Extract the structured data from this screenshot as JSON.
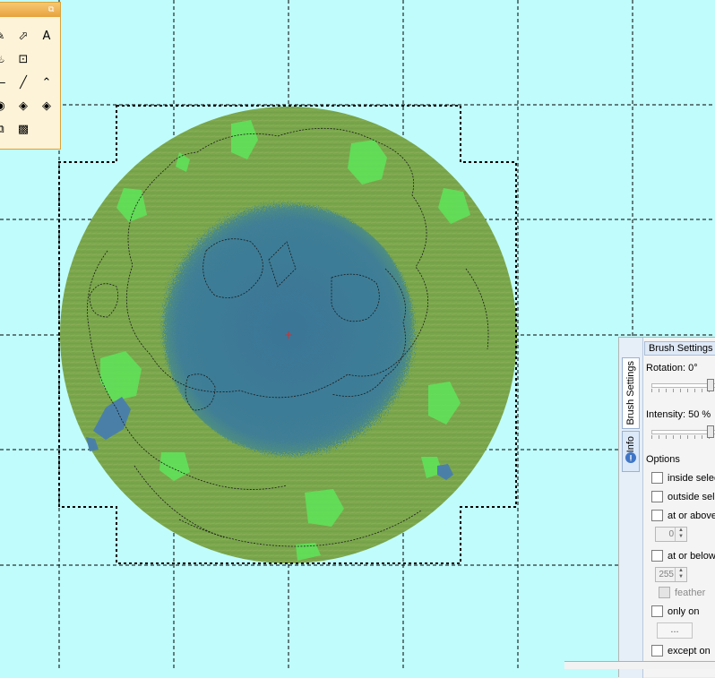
{
  "toolbox": {
    "restore_icon": "restore-window-icon",
    "tools": [
      {
        "name": "pencil-tool-icon",
        "glyph": "✎"
      },
      {
        "name": "fill-tool-icon",
        "glyph": "⬀"
      },
      {
        "name": "text-tool-icon",
        "glyph": "A"
      },
      {
        "name": "fire-tool-icon",
        "glyph": "♨"
      },
      {
        "name": "stamp-tool-icon",
        "glyph": "⊡"
      },
      {
        "name": "empty-slot",
        "glyph": ""
      },
      {
        "name": "line-tool-icon",
        "glyph": "—"
      },
      {
        "name": "slope-line-tool-icon",
        "glyph": "╱"
      },
      {
        "name": "ridge-tool-icon",
        "glyph": "⌃"
      },
      {
        "name": "erosion-tool-icon",
        "glyph": "◉"
      },
      {
        "name": "raise-tool-icon",
        "glyph": "◈"
      },
      {
        "name": "lower-tool-icon",
        "glyph": "◈"
      },
      {
        "name": "copy-tool-icon",
        "glyph": "⧉"
      },
      {
        "name": "noise-tool-icon",
        "glyph": "▩"
      },
      {
        "name": "empty-slot",
        "glyph": ""
      }
    ]
  },
  "panel": {
    "header": "Brush Settings",
    "tabs": {
      "brush_settings": "Brush Settings",
      "info": "Info"
    },
    "rotation_label": "Rotation: 0°",
    "rotation_value": 0,
    "intensity_label": "Intensity: 50 %",
    "intensity_value": 50,
    "options_label": "Options",
    "inside_selection": "inside selection",
    "outside_selection": "outside selection",
    "at_or_above": "at or above",
    "at_or_above_value": "0",
    "at_or_below": "at or below",
    "at_or_below_value": "255",
    "feather": "feather",
    "only_on": "only on",
    "only_on_button": "...",
    "except_on": "except on"
  },
  "colors": {
    "background": "#c0fcfc",
    "water": "#3e7a9a",
    "land": "#78a84a",
    "bright_green": "#5ee55a",
    "toolbox_border": "#d8a43a"
  }
}
